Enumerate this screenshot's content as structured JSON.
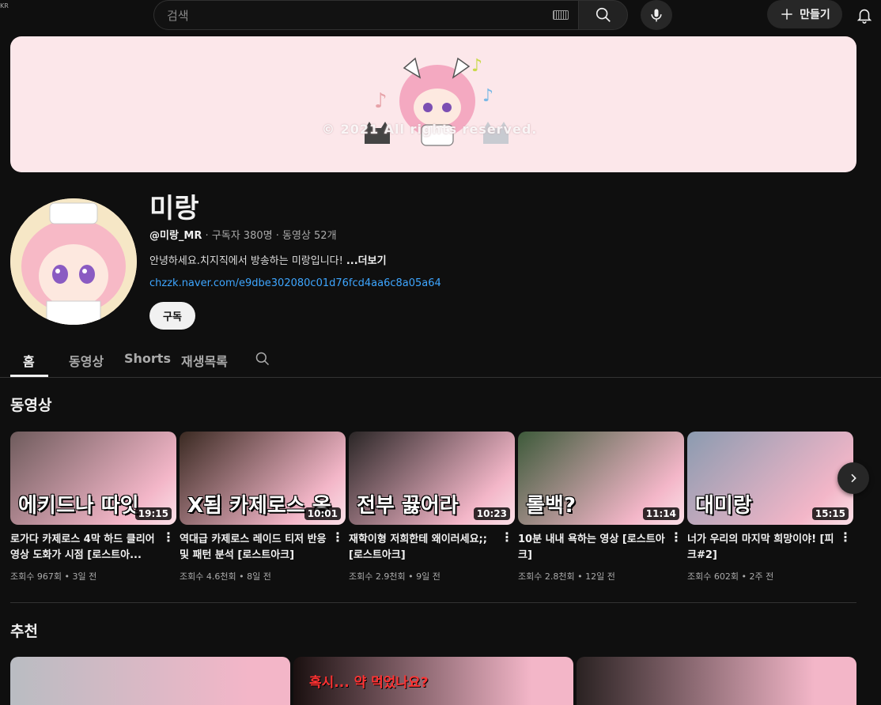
{
  "header": {
    "region_badge": "KR",
    "search_placeholder": "검색",
    "create_label": "만들기",
    "icons": [
      "keyboard-icon",
      "search-icon",
      "mic-icon",
      "plus-icon",
      "bell-icon"
    ]
  },
  "banner": {
    "watermark": "© 2021 All rights reserved."
  },
  "channel": {
    "name": "미랑",
    "handle": "@미랑_MR",
    "subscribers": "구독자 380명",
    "videos_count": "동영상 52개",
    "separator": "·",
    "description": "안녕하세요.치지직에서 방송하는 미랑입니다!",
    "more_label": "...더보기",
    "link": "chzzk.naver.com/e9dbe302080c01d76fcd4aa6c8a05a64",
    "subscribe_label": "구독"
  },
  "tabs": [
    {
      "label": "홈",
      "active": true
    },
    {
      "label": "동영상",
      "active": false
    },
    {
      "label": "Shorts",
      "active": false
    },
    {
      "label": "재생목록",
      "active": false
    }
  ],
  "sections": {
    "videos_title": "동영상",
    "recommended_title": "추천"
  },
  "videos": [
    {
      "overlay": "에키드나 따잇",
      "duration": "19:15",
      "title": "로가다 카제로스 4막 하드 클리어 영상 도화가 시점 [로스트아...",
      "views": "조회수 967회",
      "age": "3일 전",
      "bg": "#6e5b5c"
    },
    {
      "overlay": "X됨 카제로스 옹",
      "duration": "10:01",
      "title": "역대급 카제로스 레이드 티저 반응 및 패턴 분석 [로스트아크]",
      "views": "조회수 4.6천회",
      "age": "8일 전",
      "bg": "#3a2a22"
    },
    {
      "overlay": "전부 끓어라",
      "duration": "10:23",
      "title": "재학이형 저희한테 왜이러세요;; [로스트아크]",
      "views": "조회수 2.9천회",
      "age": "9일 전",
      "bg": "#2a2626"
    },
    {
      "overlay": "롤백?",
      "duration": "11:14",
      "title": "10분 내내 욕하는 영상 [로스트아크]",
      "views": "조회수 2.8천회",
      "age": "12일 전",
      "bg": "#3d5a3a"
    },
    {
      "overlay": "대미랑",
      "duration": "15:15",
      "title": "너가 우리의 마지막 희망이야! [피크#2]",
      "views": "조회수 602회",
      "age": "2주 전",
      "bg": "#8b9bb0"
    }
  ],
  "recommended": [
    {
      "overlay": "",
      "bg": "#b9bcc2"
    },
    {
      "overlay": "혹시... 약 먹었나요?",
      "bg": "#1a1010"
    },
    {
      "overlay": "",
      "bg": "#2a2222"
    }
  ],
  "colors": {
    "background": "#0f0f0f",
    "banner": "#fce7ea",
    "link": "#3ea6ff",
    "text": "#f1f1f1",
    "muted": "#aaaaaa"
  }
}
